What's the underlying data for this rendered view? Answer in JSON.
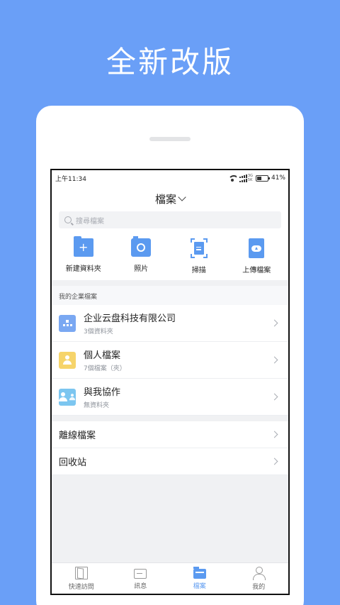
{
  "headline": "全新改版",
  "status": {
    "time": "上午11:34",
    "net_top": "3G",
    "net_bottom": "5K",
    "battery": "41%",
    "battery_level": 0.41
  },
  "nav": {
    "title": "檔案"
  },
  "search": {
    "placeholder": "搜尋檔案"
  },
  "quick_actions": [
    {
      "label": "新建資料夾",
      "icon": "new-folder-icon"
    },
    {
      "label": "照片",
      "icon": "camera-icon"
    },
    {
      "label": "掃描",
      "icon": "scan-icon"
    },
    {
      "label": "上傳檔案",
      "icon": "upload-icon"
    }
  ],
  "enterprise": {
    "section_title": "我的企業檔案",
    "items": [
      {
        "title": "企业云盘科技有限公司",
        "subtitle": "3個資料夾",
        "color": "#7aa8f2",
        "icon": "org-icon"
      },
      {
        "title": "個人檔案",
        "subtitle": "7個檔案（夾）",
        "color": "#f6d46a",
        "icon": "person-icon"
      },
      {
        "title": "與我協作",
        "subtitle": "無資料夾",
        "color": "#7cc6f0",
        "icon": "collaborate-icon"
      }
    ]
  },
  "others": [
    {
      "label": "離線檔案"
    },
    {
      "label": "回收站"
    }
  ],
  "tabs": [
    {
      "label": "快速訪問",
      "icon": "door-icon",
      "active": false
    },
    {
      "label": "訊息",
      "icon": "message-icon",
      "active": false
    },
    {
      "label": "檔案",
      "icon": "files-icon",
      "active": true
    },
    {
      "label": "我的",
      "icon": "profile-icon",
      "active": false
    }
  ],
  "colors": {
    "background": "#6a9ff7",
    "accent": "#5b9af0"
  }
}
